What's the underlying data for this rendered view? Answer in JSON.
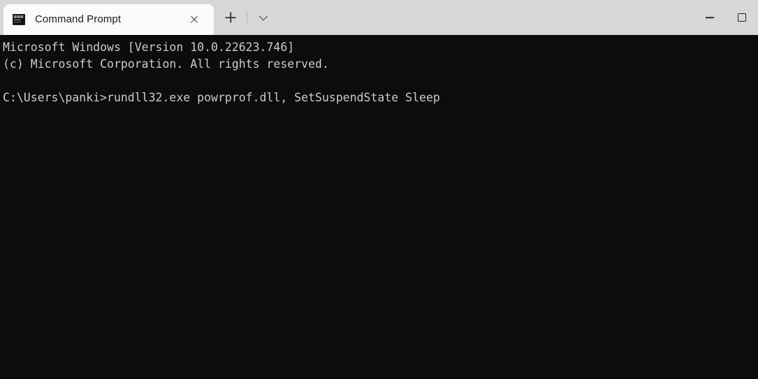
{
  "window": {
    "title": "Command Prompt",
    "background_color": "#0c0c0c",
    "titlebar_color": "#d7d7d7",
    "text_color": "#cccccc"
  },
  "titlebar": {
    "tabs": [
      {
        "label": "Command Prompt",
        "icon": "command-prompt-icon",
        "close_label": "×",
        "active": true
      }
    ],
    "new_tab_label": "+",
    "dropdown_label": "⌄",
    "window_controls": {
      "minimize_label": "—",
      "maximize_label": "□"
    }
  },
  "terminal": {
    "lines": [
      "Microsoft Windows [Version 10.0.22623.746]",
      "(c) Microsoft Corporation. All rights reserved.",
      "",
      "C:\\Users\\panki>rundll32.exe powrprof.dll, SetSuspendState Sleep"
    ]
  }
}
